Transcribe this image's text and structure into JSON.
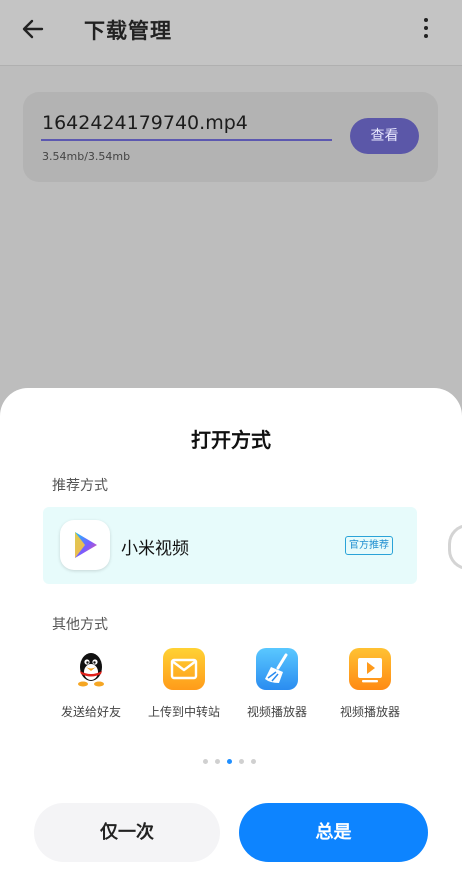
{
  "appbar": {
    "title": "下载管理",
    "back_icon": "arrow-left-icon",
    "more_icon": "more-vertical-icon"
  },
  "download": {
    "filename": "1642424179740.mp4",
    "progress": 1.0,
    "size": "3.54mb/3.54mb",
    "view_label": "查看"
  },
  "sheet": {
    "title": "打开方式",
    "recommended_label": "推荐方式",
    "recommended_app": {
      "name": "小米视频",
      "badge": "官方推荐",
      "icon": "mi-video-play-icon"
    },
    "other_label": "其他方式",
    "apps": [
      {
        "label": "发送给好友",
        "icon": "qq-penguin-icon"
      },
      {
        "label": "上传到中转站",
        "icon": "mail-envelope-icon"
      },
      {
        "label": "视频播放器",
        "icon": "broom-cleaner-icon"
      },
      {
        "label": "视频播放器",
        "icon": "video-player-icon"
      }
    ],
    "page_count": 5,
    "page_active": 3,
    "btn_once": "仅一次",
    "btn_always": "总是"
  },
  "colors": {
    "accent": "#0d84ff",
    "badge": "#1f8fd0",
    "rec_bg": "#e7fbfb"
  }
}
